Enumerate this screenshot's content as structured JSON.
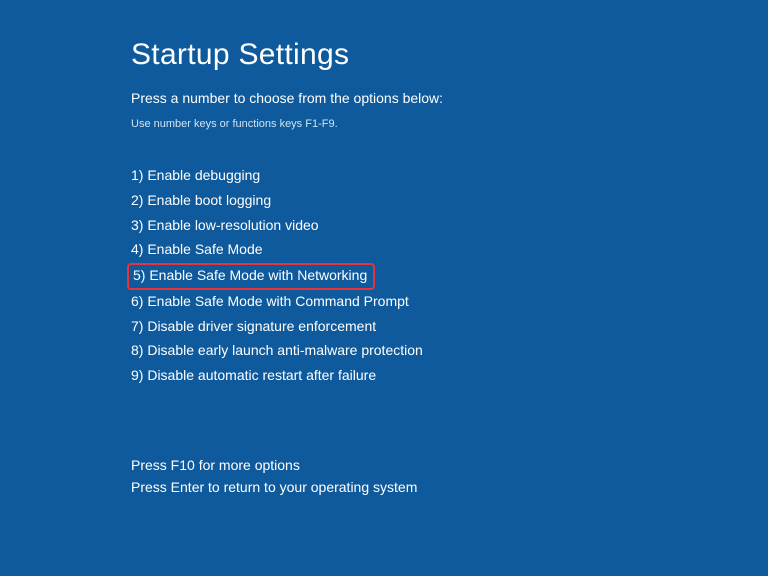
{
  "title": "Startup Settings",
  "subtitle": "Press a number to choose from the options below:",
  "hint": "Use number keys or functions keys F1-F9.",
  "options": [
    "1) Enable debugging",
    "2) Enable boot logging",
    "3) Enable low-resolution video",
    "4) Enable Safe Mode",
    "5) Enable Safe Mode with Networking",
    "6) Enable Safe Mode with Command Prompt",
    "7) Disable driver signature enforcement",
    "8) Disable early launch anti-malware protection",
    "9) Disable automatic restart after failure"
  ],
  "highlighted_index": 4,
  "footer": {
    "line1": "Press F10 for more options",
    "line2": "Press Enter to return to your operating system"
  }
}
